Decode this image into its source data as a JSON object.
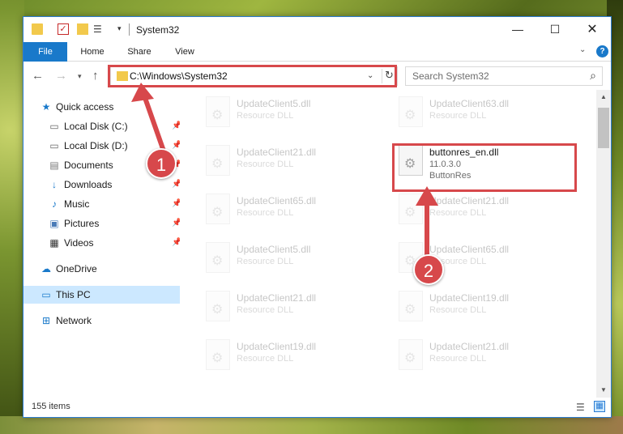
{
  "window": {
    "title": "System32",
    "min_glyph": "—",
    "max_glyph": "☐",
    "close_glyph": "✕"
  },
  "ribbon": {
    "tabs": [
      "File",
      "Home",
      "Share",
      "View"
    ]
  },
  "address_bar": {
    "path": "C:\\Windows\\System32"
  },
  "search": {
    "placeholder": "Search System32"
  },
  "nav_pane": {
    "items": [
      {
        "label": "Quick access",
        "icon": "star-icon",
        "glyph": "★"
      },
      {
        "label": "Local Disk (C:)",
        "icon": "drive-icon",
        "glyph": "▭",
        "pinned": true
      },
      {
        "label": "Local Disk (D:)",
        "icon": "drive-icon",
        "glyph": "▭",
        "pinned": true
      },
      {
        "label": "Documents",
        "icon": "documents-icon",
        "glyph": "▤",
        "pinned": true
      },
      {
        "label": "Downloads",
        "icon": "download-icon",
        "glyph": "↓",
        "pinned": true
      },
      {
        "label": "Music",
        "icon": "music-icon",
        "glyph": "♪",
        "pinned": true
      },
      {
        "label": "Pictures",
        "icon": "pictures-icon",
        "glyph": "▣",
        "pinned": true
      },
      {
        "label": "Videos",
        "icon": "videos-icon",
        "glyph": "▦",
        "pinned": true
      },
      {
        "label": "OneDrive",
        "icon": "cloud-icon",
        "glyph": "☁"
      },
      {
        "label": "This PC",
        "icon": "computer-icon",
        "glyph": "▭",
        "selected": true
      },
      {
        "label": "Network",
        "icon": "network-icon",
        "glyph": "⊞"
      }
    ]
  },
  "files": {
    "left": [
      {
        "name": "UpdateClient5.dll",
        "desc": "Resource DLL"
      },
      {
        "name": "UpdateClient21.dll",
        "desc": "Resource DLL"
      },
      {
        "name": "UpdateClient65.dll",
        "desc": "Resource DLL"
      },
      {
        "name": "UpdateClient5.dll",
        "desc": "Resource DLL"
      },
      {
        "name": "UpdateClient21.dll",
        "desc": "Resource DLL"
      },
      {
        "name": "UpdateClient19.dll",
        "desc": "Resource DLL"
      }
    ],
    "right": [
      {
        "name": "UpdateClient63.dll",
        "desc": "Resource DLL"
      },
      {
        "name": "buttonres_en.dll",
        "desc": "11.0.3.0",
        "desc2": "ButtonRes",
        "highlighted": true
      },
      {
        "name": "UpdateClient21.dll",
        "desc": "Resource DLL"
      },
      {
        "name": "UpdateClient65.dll",
        "desc": "Resource DLL"
      },
      {
        "name": "UpdateClient19.dll",
        "desc": "Resource DLL"
      },
      {
        "name": "UpdateClient21.dll",
        "desc": "Resource DLL"
      }
    ]
  },
  "status": {
    "item_count": "155 items"
  },
  "annotations": {
    "step1": "1",
    "step2": "2",
    "color": "#d7484b"
  }
}
